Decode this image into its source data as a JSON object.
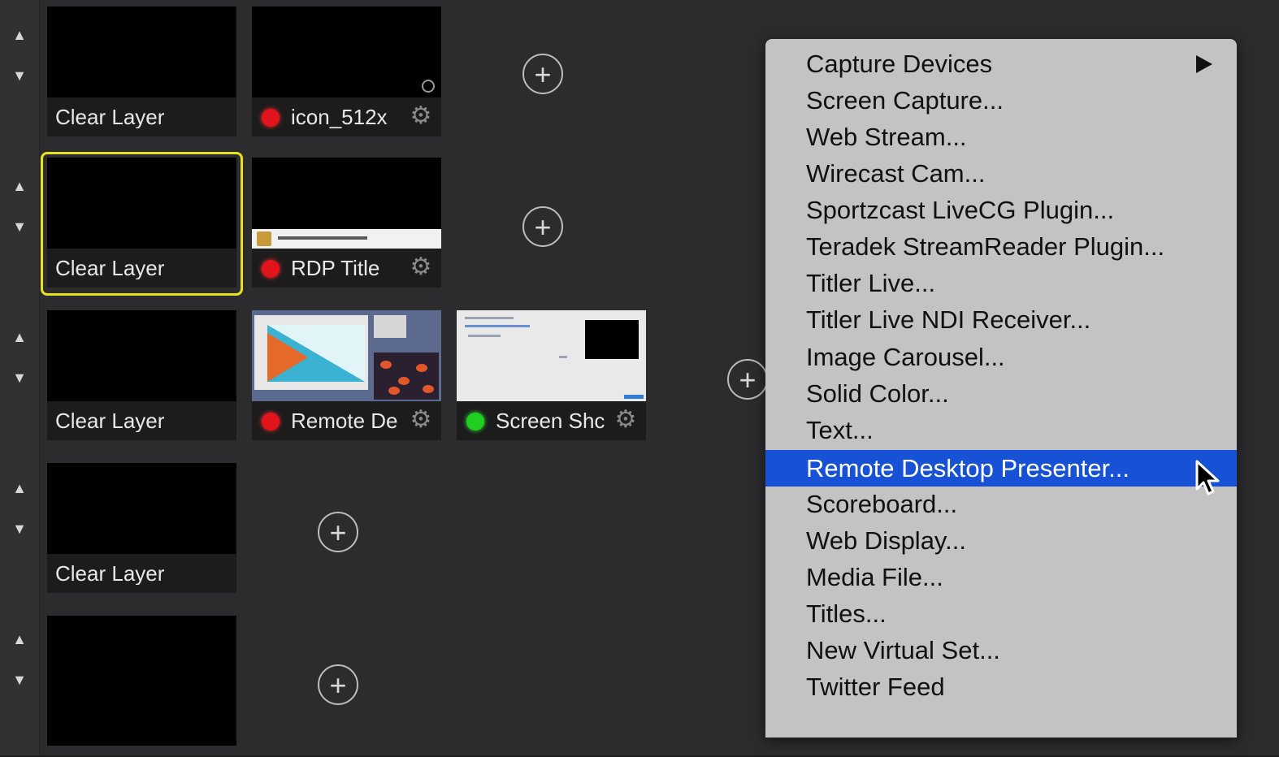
{
  "layers": [
    {
      "clear_label": "Clear Layer",
      "shots": [
        {
          "label": "icon_512x",
          "status": "red"
        }
      ]
    },
    {
      "clear_label": "Clear Layer",
      "selected": true,
      "shots": [
        {
          "label": "RDP Title",
          "status": "red"
        }
      ]
    },
    {
      "clear_label": "Clear Layer",
      "shots": [
        {
          "label": "Remote De",
          "status": "red"
        },
        {
          "label": "Screen Shc",
          "status": "green"
        }
      ]
    },
    {
      "clear_label": "Clear Layer",
      "shots": []
    },
    {
      "clear_label": "",
      "shots": []
    }
  ],
  "icons": {
    "up": "▲",
    "down": "▼",
    "plus": "+",
    "gear": "⚙"
  },
  "colors": {
    "selected_border": "#e8e21e",
    "status_red": "#e2141b",
    "status_green": "#20d020",
    "menu_highlight": "#1651d6"
  },
  "menu": {
    "items": [
      {
        "label": "Capture Devices",
        "submenu": true
      },
      {
        "label": "Screen Capture..."
      },
      {
        "label": "Web Stream..."
      },
      {
        "label": "Wirecast Cam..."
      },
      {
        "label": "Sportzcast LiveCG Plugin..."
      },
      {
        "label": "Teradek StreamReader Plugin..."
      },
      {
        "label": "Titler Live..."
      },
      {
        "label": "Titler Live NDI Receiver..."
      },
      {
        "label": "Image Carousel..."
      },
      {
        "label": "Solid Color..."
      },
      {
        "label": "Text..."
      },
      {
        "label": "Remote Desktop Presenter...",
        "highlighted": true
      },
      {
        "label": "Scoreboard..."
      },
      {
        "label": "Web Display..."
      },
      {
        "label": "Media File..."
      },
      {
        "label": "Titles..."
      },
      {
        "label": "New Virtual Set..."
      },
      {
        "label": "Twitter Feed"
      }
    ]
  }
}
